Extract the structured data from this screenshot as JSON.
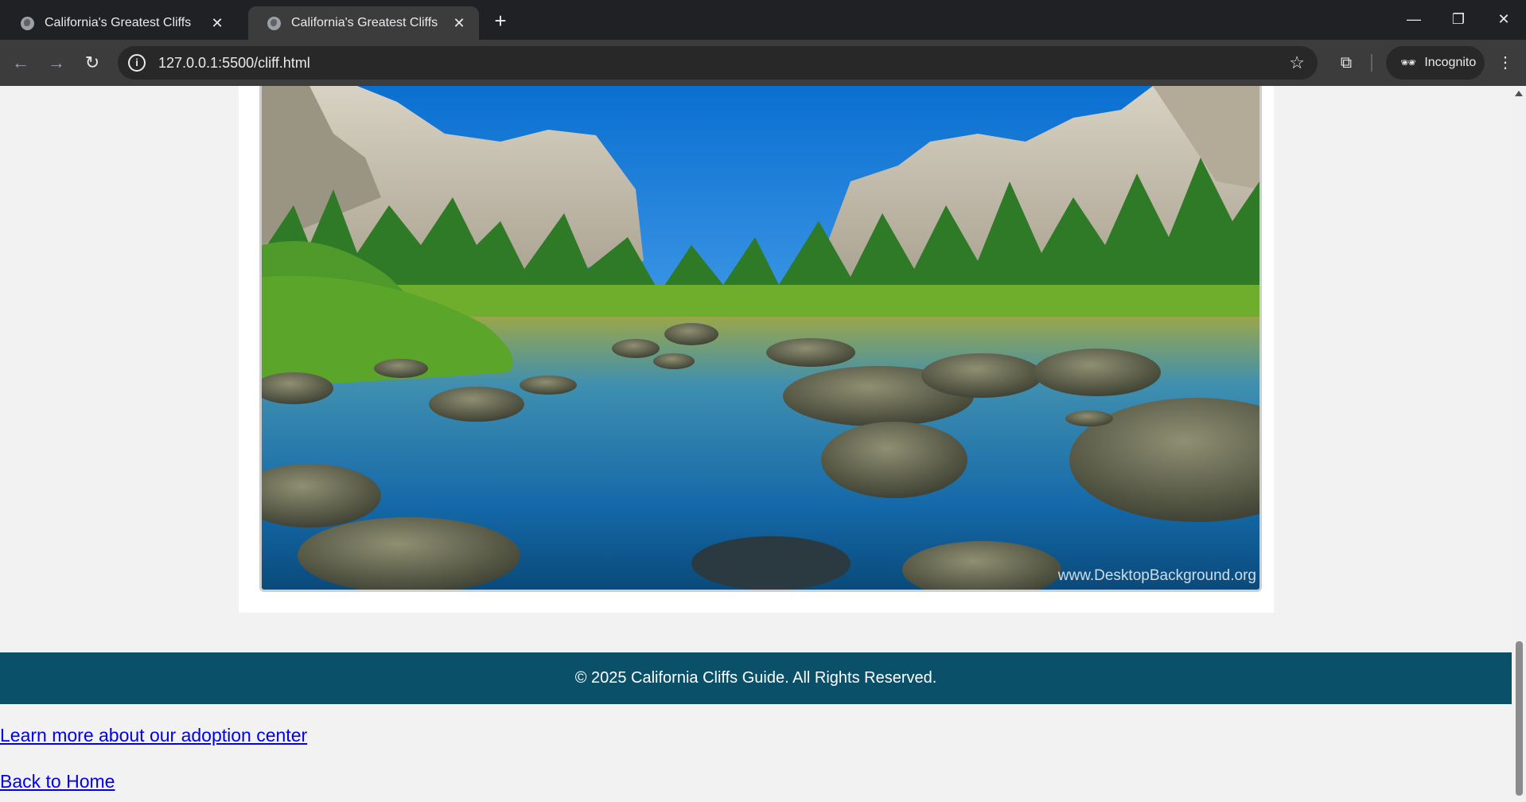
{
  "browser": {
    "tabs": [
      {
        "title": "California's Greatest Cliffs",
        "active": false
      },
      {
        "title": "California's Greatest Cliffs",
        "active": true
      }
    ],
    "new_tab_symbol": "+",
    "close_symbol": "✕",
    "window_controls": {
      "minimize": "—",
      "restore": "❐",
      "close": "✕"
    },
    "url": "127.0.0.1:5500/cliff.html",
    "incognito_label": "Incognito",
    "icons": {
      "back": "back-arrow-icon",
      "forward": "forward-arrow-icon",
      "reload": "reload-icon",
      "site_info": "info-icon",
      "bookmark": "star-icon",
      "cast": "cast-search-icon",
      "incognito": "incognito-icon",
      "menu": "kebab-menu-icon"
    }
  },
  "page": {
    "image_watermark": "www.DesktopBackground.org",
    "footer_text": "© 2025 California Cliffs Guide. All Rights Reserved.",
    "links": {
      "adoption": "Learn more about our adoption center",
      "home": "Back to Home"
    }
  }
}
